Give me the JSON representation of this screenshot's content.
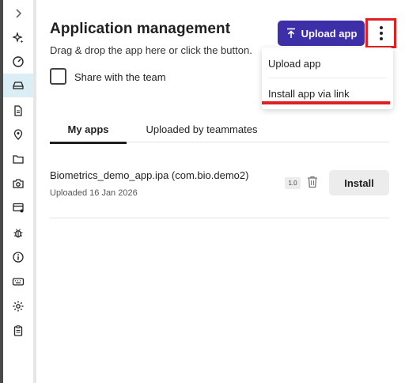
{
  "header": {
    "title": "Application management",
    "subtitle": "Drag & drop the app here or click the button.",
    "upload_label": "Upload app",
    "more_icon": "more-vertical-icon"
  },
  "share": {
    "label": "Share with the team",
    "checked": false
  },
  "menu": {
    "items": [
      {
        "label": "Upload app"
      },
      {
        "label": "Install app via link"
      }
    ]
  },
  "tabs": [
    {
      "label": "My apps",
      "active": true
    },
    {
      "label": "Uploaded by teammates",
      "active": false
    }
  ],
  "apps": [
    {
      "name": "Biometrics_demo_app.ipa (com.bio.demo2)",
      "uploaded": "Uploaded 16 Jan 2026",
      "version": "1.0",
      "install_label": "Install"
    }
  ],
  "sidebar": {
    "icons": [
      "chevron-right-icon",
      "sparkle-icon",
      "speedometer-icon",
      "drive-icon",
      "document-icon",
      "location-pin-icon",
      "folder-icon",
      "camera-icon",
      "card-settings-icon",
      "bug-icon",
      "info-icon",
      "keyboard-icon",
      "gear-icon",
      "clipboard-icon"
    ],
    "active_index": 3
  },
  "colors": {
    "accent": "#3d2fa8",
    "highlight": "#e02020",
    "sidebar_active": "#dbeef5"
  }
}
